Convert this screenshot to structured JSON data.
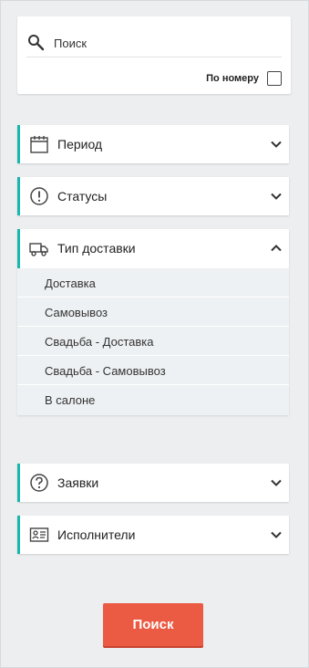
{
  "search": {
    "placeholder": "Поиск",
    "by_number_label": "По номеру",
    "by_number_checked": false
  },
  "filters": {
    "period": {
      "label": "Период",
      "icon": "calendar-icon"
    },
    "statuses": {
      "label": "Статусы",
      "icon": "exclamation-circle-icon"
    },
    "delivery_type": {
      "label": "Тип доставки",
      "icon": "truck-icon",
      "expanded": true,
      "options": [
        "Доставка",
        "Самовывоз",
        "Свадьба - Доставка",
        "Свадьба - Самовывоз",
        "В салоне"
      ]
    },
    "requests": {
      "label": "Заявки",
      "icon": "question-circle-icon"
    },
    "performers": {
      "label": "Исполнители",
      "icon": "id-card-icon"
    }
  },
  "actions": {
    "search_button": "Поиск"
  },
  "colors": {
    "accent": "#1cb5b0",
    "primary_button": "#eb5a42",
    "background": "#eceef0"
  }
}
